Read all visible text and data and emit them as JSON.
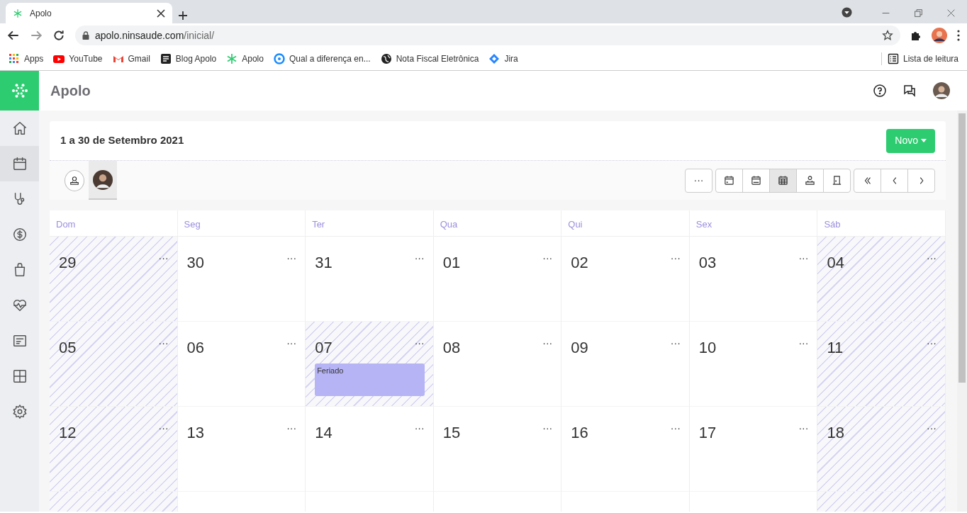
{
  "browser": {
    "tab_title": "Apolo",
    "url_domain": "apolo.ninsaude.com",
    "url_path": "/inicial/",
    "bookmarks": [
      {
        "label": "Apps",
        "kind": "apps"
      },
      {
        "label": "YouTube",
        "kind": "youtube"
      },
      {
        "label": "Gmail",
        "kind": "gmail"
      },
      {
        "label": "Blog Apolo",
        "kind": "blog"
      },
      {
        "label": "Apolo",
        "kind": "apolo"
      },
      {
        "label": "Qual a diferença en...",
        "kind": "gear"
      },
      {
        "label": "Nota Fiscal Eletrônica",
        "kind": "globe"
      },
      {
        "label": "Jira",
        "kind": "jira"
      }
    ],
    "reading_list": "Lista de leitura"
  },
  "app": {
    "title": "Apolo",
    "sidebar": [
      {
        "selected": false
      },
      {
        "selected": true
      },
      {
        "selected": false
      },
      {
        "selected": false
      },
      {
        "selected": false
      },
      {
        "selected": false
      },
      {
        "selected": false
      },
      {
        "selected": false
      },
      {
        "selected": false
      }
    ],
    "period": "1 a 30 de Setembro 2021",
    "new_button": "Novo",
    "filters": [
      {
        "kind": "all",
        "selected": false
      },
      {
        "kind": "avatar",
        "selected": true
      }
    ],
    "more_button": "···",
    "views": [
      {
        "kind": "day",
        "selected": false
      },
      {
        "kind": "week",
        "selected": false
      },
      {
        "kind": "month",
        "selected": true
      },
      {
        "kind": "professional",
        "selected": false
      },
      {
        "kind": "room",
        "selected": false
      }
    ],
    "weekdays": [
      "Dom",
      "Seg",
      "Ter",
      "Qua",
      "Qui",
      "Sex",
      "Sáb"
    ],
    "weeks": [
      [
        {
          "day": "29",
          "off": true,
          "more": "···"
        },
        {
          "day": "30",
          "off": false,
          "more": "···"
        },
        {
          "day": "31",
          "off": false,
          "more": "···"
        },
        {
          "day": "01",
          "off": false,
          "more": "···"
        },
        {
          "day": "02",
          "off": false,
          "more": "···"
        },
        {
          "day": "03",
          "off": false,
          "more": "···"
        },
        {
          "day": "04",
          "off": true,
          "more": "···"
        }
      ],
      [
        {
          "day": "05",
          "off": true,
          "more": "···"
        },
        {
          "day": "06",
          "off": false,
          "more": "···"
        },
        {
          "day": "07",
          "off": true,
          "more": "···",
          "events": [
            {
              "title": "Feriado",
              "color": "#b6b4f5"
            }
          ]
        },
        {
          "day": "08",
          "off": false,
          "more": "···"
        },
        {
          "day": "09",
          "off": false,
          "more": "···"
        },
        {
          "day": "10",
          "off": false,
          "more": "···"
        },
        {
          "day": "11",
          "off": true,
          "more": "···"
        }
      ],
      [
        {
          "day": "12",
          "off": true,
          "more": "···"
        },
        {
          "day": "13",
          "off": false,
          "more": "···"
        },
        {
          "day": "14",
          "off": false,
          "more": "···"
        },
        {
          "day": "15",
          "off": false,
          "more": "···"
        },
        {
          "day": "16",
          "off": false,
          "more": "···"
        },
        {
          "day": "17",
          "off": false,
          "more": "···"
        },
        {
          "day": "18",
          "off": true,
          "more": "···"
        }
      ],
      [
        {
          "off": true
        },
        {
          "off": false
        },
        {
          "off": false
        },
        {
          "off": false
        },
        {
          "off": false
        },
        {
          "off": false
        },
        {
          "off": true
        }
      ]
    ]
  }
}
